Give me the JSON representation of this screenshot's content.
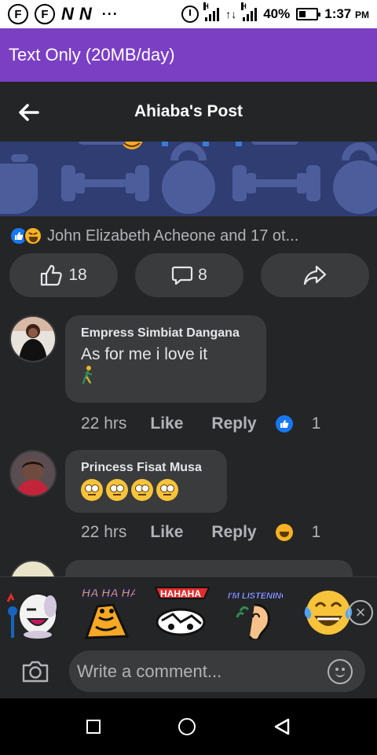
{
  "status_bar": {
    "app_icons": [
      "F",
      "F",
      "N",
      "N"
    ],
    "more": "···",
    "battery": "40%",
    "time": "1:37",
    "ampm": "PM",
    "network_label": "H"
  },
  "data_banner": {
    "text": "Text Only (20MB/day)"
  },
  "header": {
    "title": "Ahiaba's Post"
  },
  "reactions": {
    "summary": "John Elizabeth Acheone and 17 ot..."
  },
  "actions": {
    "likes": "18",
    "comments": "8"
  },
  "comments": [
    {
      "name": "Empress Simbiat Dangana",
      "text": "As for me i love it",
      "time": "22 hrs",
      "like_label": "Like",
      "reply_label": "Reply",
      "reaction": "like",
      "reaction_count": "1"
    },
    {
      "name": "Princess Fisat Musa",
      "text": "",
      "emoji": [
        "face-with-rolling-eyes",
        "face-with-rolling-eyes",
        "face-with-rolling-eyes",
        "face-with-rolling-eyes"
      ],
      "time": "22 hrs",
      "like_label": "Like",
      "reply_label": "Reply",
      "reaction": "haha",
      "reaction_count": "1"
    }
  ],
  "stickers": {
    "items": [
      {
        "name": "singing-dog-sticker"
      },
      {
        "name": "haha-sticker",
        "caption": "HA HA HA"
      },
      {
        "name": "hahaha-laughing-sticker",
        "caption": "HAHAHA"
      },
      {
        "name": "im-listening-sticker",
        "caption": "I'M LISTENING"
      },
      {
        "name": "tears-of-joy-sticker"
      }
    ]
  },
  "composer": {
    "placeholder": "Write a comment..."
  },
  "colors": {
    "background": "#242526",
    "surface": "#3a3b3c",
    "banner": "#7b3fc4",
    "like_blue": "#1877f2",
    "text_primary": "#e4e6eb",
    "text_secondary": "#b0b3b8"
  }
}
